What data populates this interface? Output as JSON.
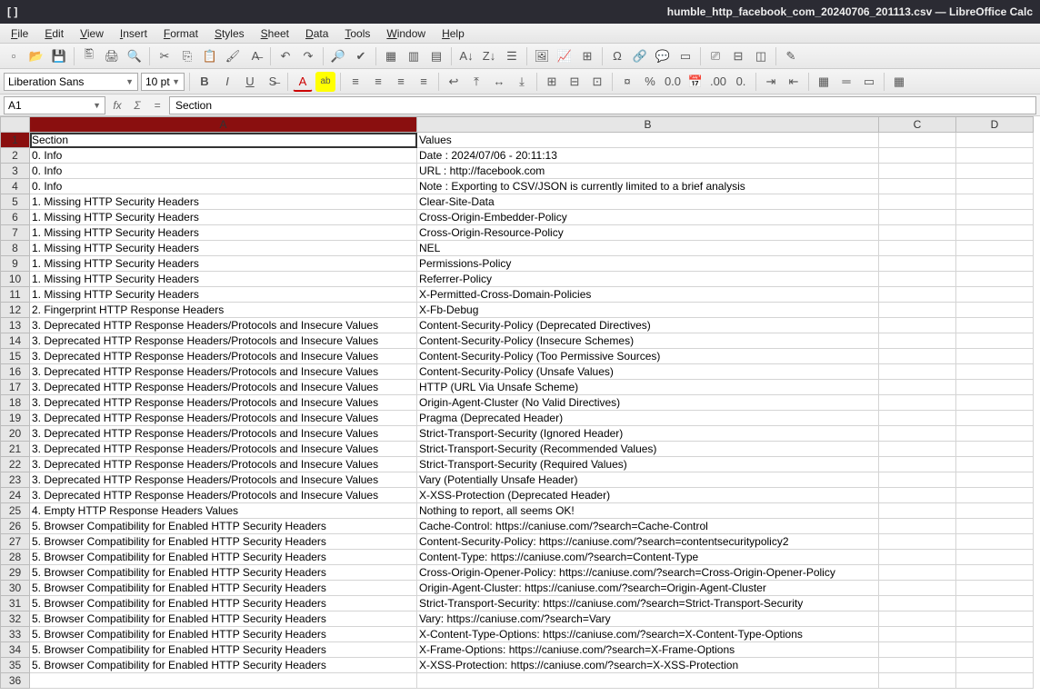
{
  "window": {
    "app_indicator": "[ ]",
    "title": "humble_http_facebook_com_20240706_201113.csv — LibreOffice Calc"
  },
  "menus": [
    "File",
    "Edit",
    "View",
    "Insert",
    "Format",
    "Styles",
    "Sheet",
    "Data",
    "Tools",
    "Window",
    "Help"
  ],
  "font": {
    "name": "Liberation Sans",
    "size": "10 pt"
  },
  "cellref": "A1",
  "formula": "Section",
  "columns": [
    "A",
    "B",
    "C",
    "D"
  ],
  "selected_cell": {
    "row": 1,
    "col": "A"
  },
  "rows": [
    {
      "n": 1,
      "A": "Section",
      "B": "Values"
    },
    {
      "n": 2,
      "A": "0. Info",
      "B": "Date : 2024/07/06 - 20:11:13"
    },
    {
      "n": 3,
      "A": "0. Info",
      "B": "URL  : http://facebook.com"
    },
    {
      "n": 4,
      "A": "0. Info",
      "B": "Note : Exporting to CSV/JSON is currently limited to a brief analysis"
    },
    {
      "n": 5,
      "A": "1. Missing HTTP Security Headers",
      "B": "Clear-Site-Data"
    },
    {
      "n": 6,
      "A": "1. Missing HTTP Security Headers",
      "B": "Cross-Origin-Embedder-Policy"
    },
    {
      "n": 7,
      "A": "1. Missing HTTP Security Headers",
      "B": "Cross-Origin-Resource-Policy"
    },
    {
      "n": 8,
      "A": "1. Missing HTTP Security Headers",
      "B": "NEL"
    },
    {
      "n": 9,
      "A": "1. Missing HTTP Security Headers",
      "B": "Permissions-Policy"
    },
    {
      "n": 10,
      "A": "1. Missing HTTP Security Headers",
      "B": "Referrer-Policy"
    },
    {
      "n": 11,
      "A": "1. Missing HTTP Security Headers",
      "B": "X-Permitted-Cross-Domain-Policies"
    },
    {
      "n": 12,
      "A": "2. Fingerprint HTTP Response Headers",
      "B": "X-Fb-Debug"
    },
    {
      "n": 13,
      "A": "3. Deprecated HTTP Response Headers/Protocols and Insecure Values",
      "B": "Content-Security-Policy (Deprecated Directives)"
    },
    {
      "n": 14,
      "A": "3. Deprecated HTTP Response Headers/Protocols and Insecure Values",
      "B": "Content-Security-Policy (Insecure Schemes)"
    },
    {
      "n": 15,
      "A": "3. Deprecated HTTP Response Headers/Protocols and Insecure Values",
      "B": "Content-Security-Policy (Too Permissive Sources)"
    },
    {
      "n": 16,
      "A": "3. Deprecated HTTP Response Headers/Protocols and Insecure Values",
      "B": "Content-Security-Policy (Unsafe Values)"
    },
    {
      "n": 17,
      "A": "3. Deprecated HTTP Response Headers/Protocols and Insecure Values",
      "B": "HTTP (URL Via Unsafe Scheme)"
    },
    {
      "n": 18,
      "A": "3. Deprecated HTTP Response Headers/Protocols and Insecure Values",
      "B": "Origin-Agent-Cluster (No Valid Directives)"
    },
    {
      "n": 19,
      "A": "3. Deprecated HTTP Response Headers/Protocols and Insecure Values",
      "B": "Pragma (Deprecated Header)"
    },
    {
      "n": 20,
      "A": "3. Deprecated HTTP Response Headers/Protocols and Insecure Values",
      "B": "Strict-Transport-Security (Ignored Header)"
    },
    {
      "n": 21,
      "A": "3. Deprecated HTTP Response Headers/Protocols and Insecure Values",
      "B": "Strict-Transport-Security (Recommended Values)"
    },
    {
      "n": 22,
      "A": "3. Deprecated HTTP Response Headers/Protocols and Insecure Values",
      "B": "Strict-Transport-Security (Required Values)"
    },
    {
      "n": 23,
      "A": "3. Deprecated HTTP Response Headers/Protocols and Insecure Values",
      "B": "Vary (Potentially Unsafe Header)"
    },
    {
      "n": 24,
      "A": "3. Deprecated HTTP Response Headers/Protocols and Insecure Values",
      "B": "X-XSS-Protection (Deprecated Header)"
    },
    {
      "n": 25,
      "A": "4. Empty HTTP Response Headers Values",
      "B": "Nothing to report, all seems OK!"
    },
    {
      "n": 26,
      "A": "5. Browser Compatibility for Enabled HTTP Security Headers",
      "B": "Cache-Control: https://caniuse.com/?search=Cache-Control"
    },
    {
      "n": 27,
      "A": "5. Browser Compatibility for Enabled HTTP Security Headers",
      "B": "Content-Security-Policy: https://caniuse.com/?search=contentsecuritypolicy2"
    },
    {
      "n": 28,
      "A": "5. Browser Compatibility for Enabled HTTP Security Headers",
      "B": "Content-Type: https://caniuse.com/?search=Content-Type"
    },
    {
      "n": 29,
      "A": "5. Browser Compatibility for Enabled HTTP Security Headers",
      "B": "Cross-Origin-Opener-Policy: https://caniuse.com/?search=Cross-Origin-Opener-Policy"
    },
    {
      "n": 30,
      "A": "5. Browser Compatibility for Enabled HTTP Security Headers",
      "B": "Origin-Agent-Cluster: https://caniuse.com/?search=Origin-Agent-Cluster"
    },
    {
      "n": 31,
      "A": "5. Browser Compatibility for Enabled HTTP Security Headers",
      "B": "Strict-Transport-Security: https://caniuse.com/?search=Strict-Transport-Security"
    },
    {
      "n": 32,
      "A": "5. Browser Compatibility for Enabled HTTP Security Headers",
      "B": "Vary: https://caniuse.com/?search=Vary"
    },
    {
      "n": 33,
      "A": "5. Browser Compatibility for Enabled HTTP Security Headers",
      "B": "X-Content-Type-Options: https://caniuse.com/?search=X-Content-Type-Options"
    },
    {
      "n": 34,
      "A": "5. Browser Compatibility for Enabled HTTP Security Headers",
      "B": "X-Frame-Options: https://caniuse.com/?search=X-Frame-Options"
    },
    {
      "n": 35,
      "A": "5. Browser Compatibility for Enabled HTTP Security Headers",
      "B": "X-XSS-Protection: https://caniuse.com/?search=X-XSS-Protection"
    },
    {
      "n": 36,
      "A": "",
      "B": ""
    }
  ],
  "toolbar1": [
    {
      "name": "new-icon",
      "glyph": "▫"
    },
    {
      "name": "open-icon",
      "glyph": "📂"
    },
    {
      "name": "save-icon",
      "glyph": "💾"
    },
    {
      "name": "sep"
    },
    {
      "name": "export-pdf-icon",
      "glyph": "🖺"
    },
    {
      "name": "print-icon",
      "glyph": "🖨"
    },
    {
      "name": "print-preview-icon",
      "glyph": "🔍"
    },
    {
      "name": "sep"
    },
    {
      "name": "cut-icon",
      "glyph": "✂"
    },
    {
      "name": "copy-icon",
      "glyph": "⎘"
    },
    {
      "name": "paste-icon",
      "glyph": "📋"
    },
    {
      "name": "clone-format-icon",
      "glyph": "🖌"
    },
    {
      "name": "clear-format-icon",
      "glyph": "A̶"
    },
    {
      "name": "sep"
    },
    {
      "name": "undo-icon",
      "glyph": "↶"
    },
    {
      "name": "redo-icon",
      "glyph": "↷"
    },
    {
      "name": "sep"
    },
    {
      "name": "find-icon",
      "glyph": "🔎"
    },
    {
      "name": "spellcheck-icon",
      "glyph": "✔"
    },
    {
      "name": "sep"
    },
    {
      "name": "row-icon",
      "glyph": "▦"
    },
    {
      "name": "column-icon",
      "glyph": "▥"
    },
    {
      "name": "delete-cells-icon",
      "glyph": "▤"
    },
    {
      "name": "sep"
    },
    {
      "name": "sort-asc-icon",
      "glyph": "A↓"
    },
    {
      "name": "sort-desc-icon",
      "glyph": "Z↓"
    },
    {
      "name": "autofilter-icon",
      "glyph": "☰"
    },
    {
      "name": "sep"
    },
    {
      "name": "image-icon",
      "glyph": "🖼"
    },
    {
      "name": "chart-icon",
      "glyph": "📈"
    },
    {
      "name": "pivot-icon",
      "glyph": "⊞"
    },
    {
      "name": "sep"
    },
    {
      "name": "special-char-icon",
      "glyph": "Ω"
    },
    {
      "name": "hyperlink-icon",
      "glyph": "🔗"
    },
    {
      "name": "comment-icon",
      "glyph": "💬"
    },
    {
      "name": "header-footer-icon",
      "glyph": "▭"
    },
    {
      "name": "sep"
    },
    {
      "name": "define-print-area-icon",
      "glyph": "⎚"
    },
    {
      "name": "freeze-icon",
      "glyph": "⊟"
    },
    {
      "name": "split-window-icon",
      "glyph": "◫"
    },
    {
      "name": "sep"
    },
    {
      "name": "show-draw-icon",
      "glyph": "✎"
    }
  ],
  "toolbar2_right": [
    {
      "name": "bold-icon",
      "glyph": "B",
      "style": "font-weight:bold"
    },
    {
      "name": "italic-icon",
      "glyph": "I",
      "style": "font-style:italic"
    },
    {
      "name": "underline-icon",
      "glyph": "U",
      "style": "text-decoration:underline"
    },
    {
      "name": "strikethrough-icon",
      "glyph": "S̶"
    },
    {
      "name": "sep"
    },
    {
      "name": "font-color-icon",
      "glyph": "A",
      "style": "color:#c00;border-bottom:2px solid #c00"
    },
    {
      "name": "highlight-color-icon",
      "glyph": "ab",
      "style": "background:#ff0;font-size:10px"
    },
    {
      "name": "sep"
    },
    {
      "name": "align-left-icon",
      "glyph": "≡"
    },
    {
      "name": "align-center-icon",
      "glyph": "≡"
    },
    {
      "name": "align-right-icon",
      "glyph": "≡"
    },
    {
      "name": "align-justify-icon",
      "glyph": "≡"
    },
    {
      "name": "sep"
    },
    {
      "name": "wrap-text-icon",
      "glyph": "↩"
    },
    {
      "name": "valign-top-icon",
      "glyph": "⤒"
    },
    {
      "name": "valign-middle-icon",
      "glyph": "↔"
    },
    {
      "name": "valign-bottom-icon",
      "glyph": "⤓"
    },
    {
      "name": "sep"
    },
    {
      "name": "merge-cells-icon",
      "glyph": "⊞"
    },
    {
      "name": "merge-center-icon",
      "glyph": "⊟"
    },
    {
      "name": "unmerge-icon",
      "glyph": "⊡"
    },
    {
      "name": "sep"
    },
    {
      "name": "currency-icon",
      "glyph": "¤"
    },
    {
      "name": "percent-icon",
      "glyph": "%"
    },
    {
      "name": "number-icon",
      "glyph": "0.0"
    },
    {
      "name": "date-icon",
      "glyph": "📅"
    },
    {
      "name": "add-decimal-icon",
      "glyph": ".00"
    },
    {
      "name": "remove-decimal-icon",
      "glyph": "0."
    },
    {
      "name": "sep"
    },
    {
      "name": "increase-indent-icon",
      "glyph": "⇥"
    },
    {
      "name": "decrease-indent-icon",
      "glyph": "⇤"
    },
    {
      "name": "sep"
    },
    {
      "name": "borders-icon",
      "glyph": "▦"
    },
    {
      "name": "border-style-icon",
      "glyph": "═"
    },
    {
      "name": "border-color-icon",
      "glyph": "▭"
    },
    {
      "name": "sep"
    },
    {
      "name": "conditional-format-icon",
      "glyph": "▦"
    }
  ]
}
